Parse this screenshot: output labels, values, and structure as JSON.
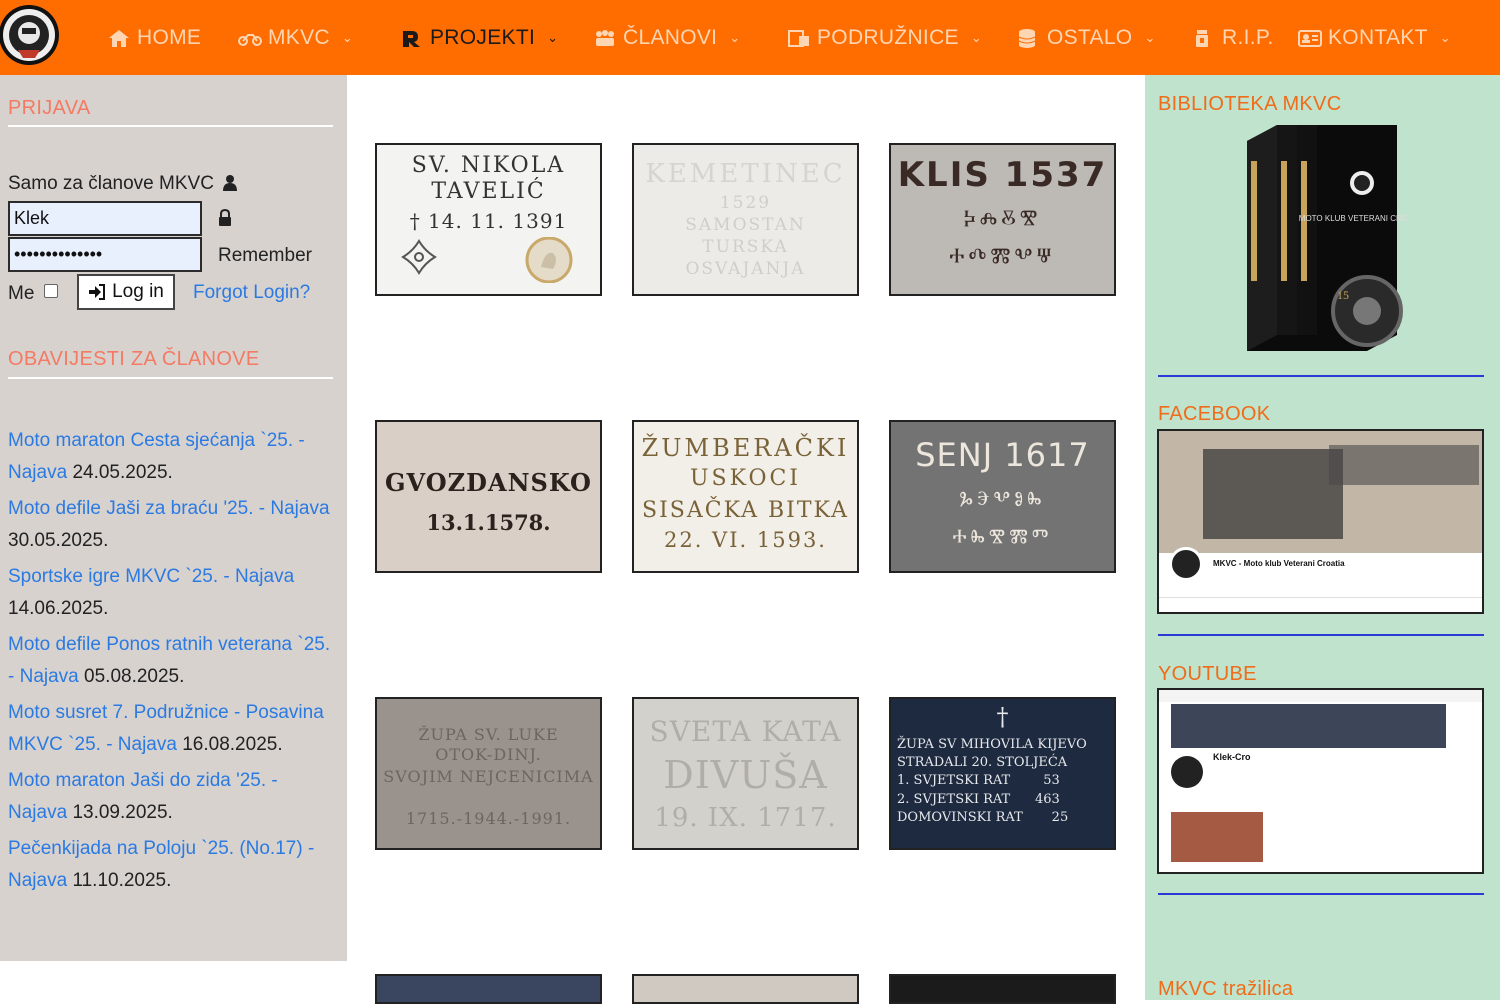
{
  "nav": {
    "items": [
      {
        "label": "HOME",
        "icon": "home-icon",
        "chevron": false
      },
      {
        "label": "MKVC",
        "icon": "motorcycle-icon",
        "chevron": true
      },
      {
        "label": "PROJEKTI",
        "icon": "road-icon",
        "chevron": true,
        "active": true
      },
      {
        "label": "ČLANOVI",
        "icon": "users-icon",
        "chevron": true
      },
      {
        "label": "PODRUŽNICE",
        "icon": "building-icon",
        "chevron": true
      },
      {
        "label": "OSTALO",
        "icon": "database-icon",
        "chevron": true
      },
      {
        "label": "R.I.P.",
        "icon": "candle-icon",
        "chevron": false
      },
      {
        "label": "KONTAKT",
        "icon": "contact-card-icon",
        "chevron": true
      }
    ],
    "colors": {
      "bar": "#ff6c00",
      "text": "#ffd6b3",
      "active": "#1a1a1a"
    }
  },
  "left": {
    "login_title": "PRIJAVA",
    "members_label": "Samo za članove MKVC",
    "username_value": "Klek",
    "password_value": "••••••••••••••",
    "remember_label": "Remember",
    "me_label": "Me",
    "login_button": "Log in",
    "forgot_link": "Forgot Login?",
    "news_title": "OBAVIJESTI ZA ČLANOVE",
    "news": [
      {
        "link": "Moto maraton Cesta sjećanja `25. - Najava",
        "date": "24.05.2025."
      },
      {
        "link": "Moto defile Jaši za braću '25. - Najava",
        "date": "30.05.2025."
      },
      {
        "link": "Sportske igre MKVC `25. - Najava",
        "date": "14.06.2025."
      },
      {
        "link": "Moto defile Ponos ratnih veterana `25. - Najava",
        "date": "05.08.2025."
      },
      {
        "link": "Moto susret 7. Podružnice - Posavina MKVC `25. - Najava",
        "date": "16.08.2025."
      },
      {
        "link": "Moto maraton Jaši do zida '25. - Najava",
        "date": "13.09.2025."
      },
      {
        "link": "Pečenkijada na Poloju `25. (No.17) - Najava",
        "date": "11.10.2025."
      }
    ]
  },
  "tiles": [
    {
      "lines": [
        "SV. NIKOLA",
        "TAVELIĆ",
        "† 14. 11. 1391"
      ]
    },
    {
      "lines": [
        "KEMETINEC",
        "1529",
        "SAMOSTAN",
        "TURSKA",
        "OSVAJANJA"
      ]
    },
    {
      "lines": [
        "KLIS 1537",
        "ⰽⰾⰻⰺ",
        "ⰰⰴⰿⰲⱋ"
      ]
    },
    {
      "lines": [
        "GVOZDANSKO",
        "13.1.1578."
      ]
    },
    {
      "lines": [
        "ŽUMBERAČKI",
        "USKOCI",
        "SISAČKA BITKA",
        "22. VI. 1593."
      ]
    },
    {
      "lines": [
        "SENJ 1617",
        "ⰳⰵⰲⱁⰸ",
        "ⰰⰸⰺⰿⱅ"
      ]
    },
    {
      "lines": [
        "ŽUPA SV. LUKE",
        "OTOK-DINJ.",
        "SVOJIM NEJCENICIMA",
        "1715.-1944.-1991."
      ]
    },
    {
      "lines": [
        "SVETA KATA",
        "DIVUŠA",
        "19. IX. 1717."
      ]
    },
    {
      "lines": [
        "†",
        "ŽUPA SV MIHOVILA KIJEVO",
        "STRADALI 20. STOLJEĆA",
        "1. SVJETSKI RAT        53",
        "2. SVJETSKI RAT      463",
        "DOMOVINSKI RAT       25"
      ]
    }
  ],
  "right": {
    "library_title": "BIBLIOTEKA MKVC",
    "book_spine": "MOTO KLUB VETERANI CROATIA",
    "book_years": "15",
    "facebook_title": "FACEBOOK",
    "fb_page_name": "MKVC - Moto klub Veterani Croatia",
    "youtube_title": "YOUTUBE",
    "yt_channel_name": "Klek-Cro",
    "search_title": "MKVC tražilica"
  }
}
